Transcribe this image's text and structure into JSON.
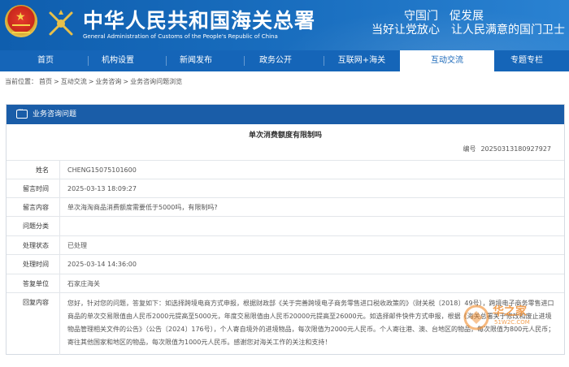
{
  "header": {
    "title_cn": "中华人民共和国海关总署",
    "title_en": "General Administration of Customs of the People's Republic of China",
    "slogan_line1": "守国门　促发展",
    "slogan_line2": "当好让党放心　让人民满意的国门卫士"
  },
  "nav": {
    "items": [
      {
        "label": "首页"
      },
      {
        "label": "机构设置"
      },
      {
        "label": "新闻发布"
      },
      {
        "label": "政务公开"
      },
      {
        "label": "互联网+海关"
      },
      {
        "label": "互动交流"
      },
      {
        "label": "专题专栏"
      }
    ],
    "active_index": 5
  },
  "breadcrumb": {
    "prefix": "当前位置：",
    "items": [
      "首页",
      "互动交流",
      "业务咨询",
      "业务咨询问题浏览"
    ],
    "separator": ">"
  },
  "panel": {
    "header_label": "业务咨询问题",
    "question_title": "单次消费额度有限制吗",
    "number_label": "编号",
    "number_value": "20250313180927927",
    "rows": [
      {
        "label": "姓名",
        "value": "CHENG15075101600"
      },
      {
        "label": "留言时间",
        "value": "2025-03-13 18:09:27"
      },
      {
        "label": "留言内容",
        "value": "单次海淘商品消费额度需要低于5000吗，有限制吗?"
      },
      {
        "label": "问题分类",
        "value": ""
      },
      {
        "label": "处理状态",
        "value": "已处理"
      },
      {
        "label": "处理时间",
        "value": "2025-03-14 14:36:00"
      },
      {
        "label": "答复单位",
        "value": "石家庄海关"
      },
      {
        "label": "回复内容",
        "value": "您好，针对您的问题，答复如下：如选择跨境电商方式申报，根据财政部《关于完善跨境电子商务零售进口税收政策的》（财关税〔2018〕49号），跨境电子商务零售进口商品的单次交易限值由人民币2000元提高至5000元，年度交易限值由人民币20000元提高至26000元。如选择邮件快件方式申报，根据《海关总署关于修改和废止进境物品管理相关文件的公告》（公告〔2024〕176号），个人寄自境外的进境物品，每次限值为2000元人民币。个人寄往港、澳、台地区的物品，每次限值为800元人民币；寄往其他国家和地区的物品，每次限值为1000元人民币。感谢您对海关工作的关注和支持！"
      }
    ]
  },
  "watermark": {
    "text": "华之家",
    "sub": "51W2C.COM"
  },
  "colors": {
    "header_blue": "#1565b8",
    "panel_head_blue": "#1a5da8",
    "watermark_orange": "#f08a2a"
  }
}
